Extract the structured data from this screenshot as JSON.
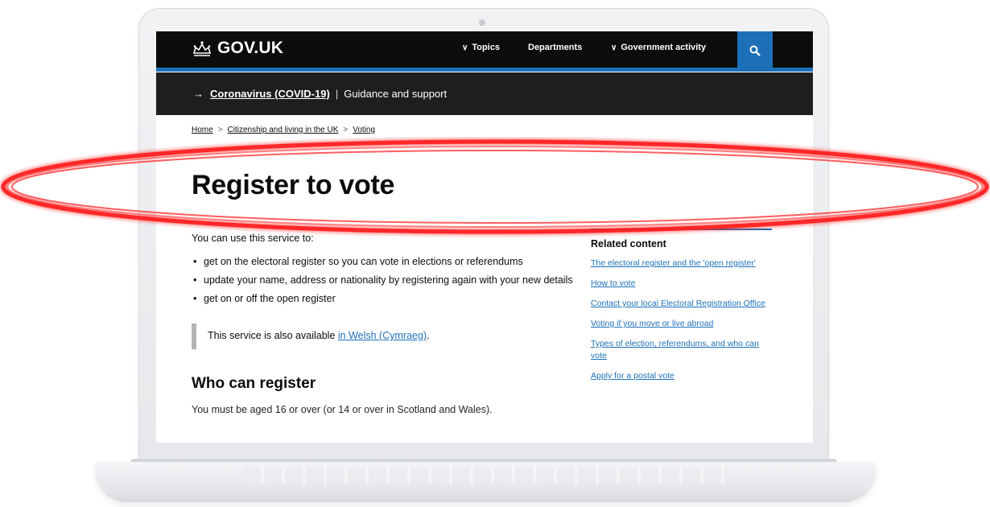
{
  "header": {
    "logo_text": "GOV.UK",
    "nav": {
      "topics": "Topics",
      "departments": "Departments",
      "government_activity": "Government activity"
    },
    "search_icon": "search-icon",
    "colors": {
      "header_bg": "#0b0c0c",
      "accent_blue": "#1d70b8"
    }
  },
  "covid_banner": {
    "arrow": "→",
    "link": "Coronavirus (COVID-19)",
    "separator": "|",
    "text": "Guidance and support"
  },
  "breadcrumbs": {
    "home": "Home",
    "citizenship": "Citizenship and living in the UK",
    "voting": "Voting",
    "separator": ">"
  },
  "page": {
    "title": "Register to vote",
    "intro": "You can use this service to:",
    "bullets": [
      "get on the electoral register so you can vote in elections or referendums",
      "update your name, address or nationality by registering again with your new details",
      "get on or off the open register"
    ],
    "inset_prefix": "This service is also available ",
    "inset_link": "in Welsh (Cymraeg)",
    "inset_suffix": ".",
    "section_heading": "Who can register",
    "cutoff_text": "You must be aged 16 or over (or 14 or over in Scotland and Wales)."
  },
  "related": {
    "title": "Related content",
    "links": [
      "The electoral register and the 'open register'",
      "How to vote",
      "Contact your local Electoral Registration Office",
      "Voting if you move or live abroad",
      "Types of election, referendums, and who can vote",
      "Apply for a postal vote"
    ]
  },
  "annotation": {
    "highlight_color": "#ff1a1a"
  }
}
